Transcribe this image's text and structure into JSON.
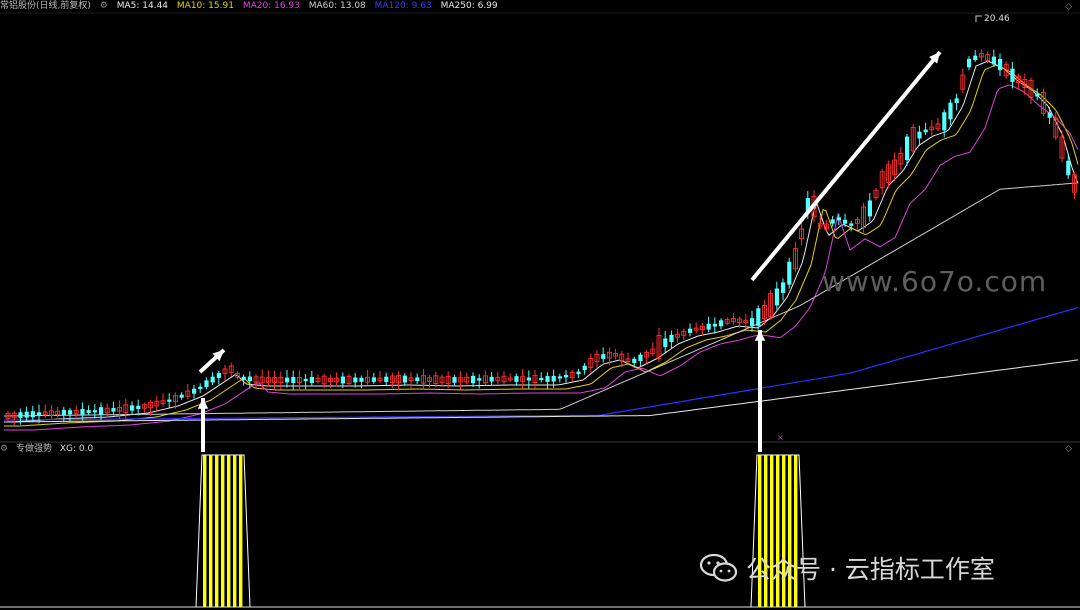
{
  "legend": {
    "stock_name": "常铝股份(日线,前复权)",
    "ma5": "MA5: 14.44",
    "ma10": "MA10: 15.91",
    "ma20": "MA20: 16.93",
    "ma60": "MA60: 13.08",
    "ma120": "MA120: 9.63",
    "ma250": "MA250: 6.99"
  },
  "colors": {
    "ma5": "#e8e8e8",
    "ma10": "#e5d200",
    "ma20": "#e040e0",
    "ma60": "#cfcfcf",
    "ma120": "#3030ff",
    "ma250": "#e8e8e8",
    "up_candle": "#ff3030",
    "down_candle": "#54ffff",
    "signal_bar": "#ffff00"
  },
  "price_high_label": "20.46",
  "indicator": {
    "name": "专做强势",
    "value": "XG: 0.0"
  },
  "watermark": "www.6o7o.com",
  "footer": {
    "brand": "公众号 · 云指标工作室"
  },
  "icons": [
    "settings-icon",
    "diamond-icon",
    "wechat-icon"
  ]
}
